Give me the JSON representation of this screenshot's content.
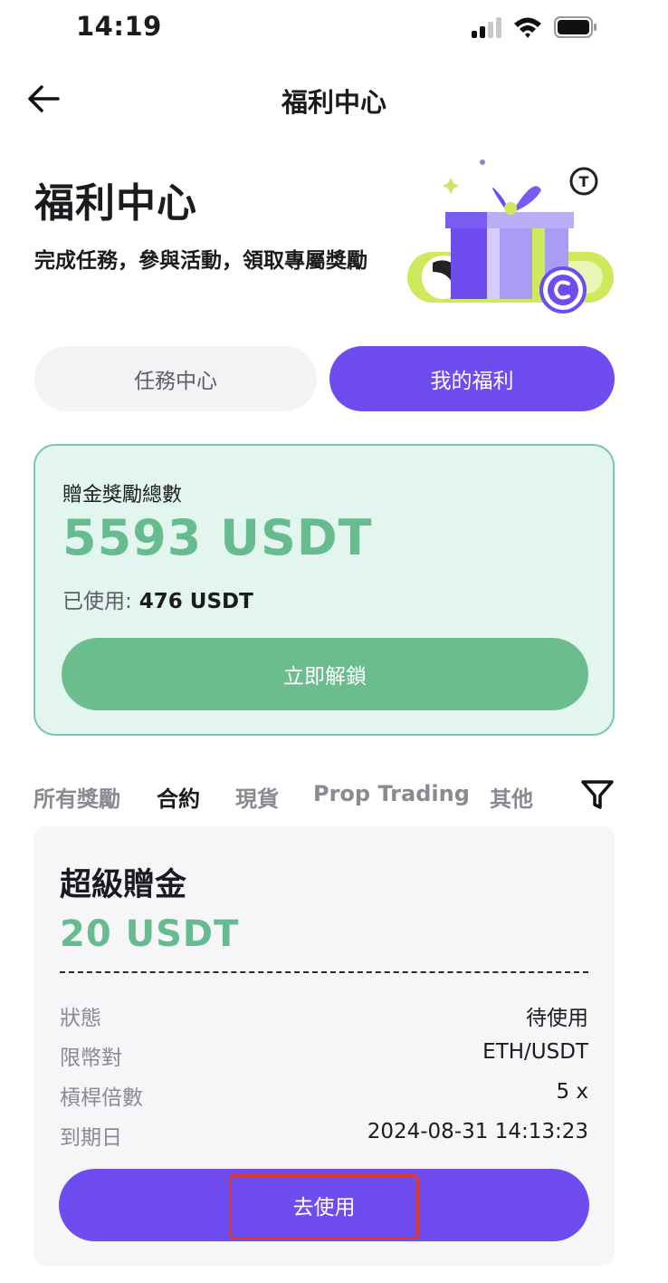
{
  "status_bar": {
    "time": "14:19"
  },
  "nav": {
    "title": "福利中心"
  },
  "hero": {
    "title": "福利中心",
    "subtitle": "完成任務，參與活動，領取專屬獎勵"
  },
  "segments": [
    {
      "label": "任務中心",
      "active": false
    },
    {
      "label": "我的福利",
      "active": true
    }
  ],
  "total_card": {
    "label": "贈金獎勵總數",
    "value": "5593 USDT",
    "used_label": "已使用:",
    "used_value": "476 USDT",
    "unlock_label": "立即解鎖"
  },
  "filter_tabs": [
    {
      "label": "所有獎勵",
      "active": false
    },
    {
      "label": "合約",
      "active": true
    },
    {
      "label": "現貨",
      "active": false
    },
    {
      "label": "Prop Trading",
      "active": false
    },
    {
      "label": "其他",
      "active": false
    }
  ],
  "bonus_card": {
    "name": "超級贈金",
    "amount": "20 USDT",
    "details": [
      {
        "key": "狀態",
        "value": "待使用"
      },
      {
        "key": "限幣對",
        "value": "ETH/USDT"
      },
      {
        "key": "槓桿倍數",
        "value": "5 x"
      },
      {
        "key": "到期日",
        "value": "2024-08-31 14:13:23"
      }
    ],
    "use_label": "去使用"
  },
  "colors": {
    "accent_purple": "#6f4cf0",
    "green": "#66bc8e",
    "card_green_bg": "#e2f5ee",
    "highlight_red": "#e03a2f"
  },
  "icons": [
    "back-arrow-icon",
    "signal-icon",
    "wifi-icon",
    "battery-icon",
    "filter-funnel-icon",
    "gift-box-illustration"
  ]
}
